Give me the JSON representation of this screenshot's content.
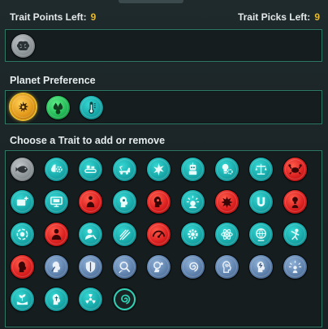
{
  "header": {
    "points_label": "Trait Points Left:",
    "points_value": "9",
    "picks_label": "Trait Picks Left:",
    "picks_value": "9"
  },
  "selected_traits": [
    {
      "icon": "brain-icon",
      "color": "#8c9396"
    }
  ],
  "planet_preference": {
    "title": "Planet Preference",
    "options": [
      {
        "icon": "arid-planet-icon",
        "color": "#e39a1b",
        "selected": true
      },
      {
        "icon": "wet-climate-icon",
        "color": "#22b956",
        "selected": false
      },
      {
        "icon": "thermometer-icon",
        "color": "#17a7a8",
        "selected": false
      }
    ]
  },
  "trait_picker": {
    "title": "Choose a Trait to add or remove",
    "rows": [
      [
        {
          "icon": "fish-icon",
          "color": "grey"
        },
        {
          "icon": "brain-gear-icon",
          "color": "teal"
        },
        {
          "icon": "conveyor-icon",
          "color": "teal"
        },
        {
          "icon": "mining-vehicle-icon",
          "color": "teal"
        },
        {
          "icon": "star-burst-icon",
          "color": "teal"
        },
        {
          "icon": "robot-icon",
          "color": "teal"
        },
        {
          "icon": "lightbulb-gear-icon",
          "color": "teal"
        },
        {
          "icon": "scales-icon",
          "color": "teal"
        },
        {
          "icon": "crab-icon",
          "color": "red"
        }
      ],
      [
        {
          "icon": "film-add-icon",
          "color": "teal"
        },
        {
          "icon": "monitor-icon",
          "color": "teal"
        },
        {
          "icon": "figure-red-icon",
          "color": "red"
        },
        {
          "icon": "head-gear-icon",
          "color": "teal"
        },
        {
          "icon": "head-gear-red-icon",
          "color": "red"
        },
        {
          "icon": "radiant-head-icon",
          "color": "teal"
        },
        {
          "icon": "splat-icon",
          "color": "red"
        },
        {
          "icon": "magnet-icon",
          "color": "teal"
        },
        {
          "icon": "figure-bulb-icon",
          "color": "red"
        }
      ],
      [
        {
          "icon": "gear-cycle-icon",
          "color": "teal"
        },
        {
          "icon": "person-red-icon",
          "color": "red"
        },
        {
          "icon": "worker-icon",
          "color": "teal"
        },
        {
          "icon": "wheat-icon",
          "color": "teal"
        },
        {
          "icon": "gauge-icon",
          "color": "red"
        },
        {
          "icon": "gear-icon",
          "color": "teal"
        },
        {
          "icon": "atom-icon",
          "color": "teal"
        },
        {
          "icon": "globe-person-icon",
          "color": "teal"
        },
        {
          "icon": "fighter-icon",
          "color": "teal"
        }
      ],
      [
        {
          "icon": "head-red-icon",
          "color": "red"
        },
        {
          "icon": "head-gears-icon",
          "color": "blue"
        },
        {
          "icon": "shield-head-icon",
          "color": "blue"
        },
        {
          "icon": "search-head-icon",
          "color": "blue"
        },
        {
          "icon": "head-ideas-icon",
          "color": "blue"
        },
        {
          "icon": "swirl-icon",
          "color": "blue"
        },
        {
          "icon": "spiral-head-icon",
          "color": "blue"
        },
        {
          "icon": "charged-head-icon",
          "color": "blue"
        },
        {
          "icon": "radiant-figure-icon",
          "color": "blue"
        }
      ],
      [
        {
          "icon": "plant-hands-icon",
          "color": "teal"
        },
        {
          "icon": "head-tree-icon",
          "color": "teal"
        },
        {
          "icon": "radiation-icon",
          "color": "teal"
        },
        {
          "icon": "spiral-galaxy-icon",
          "color": "outline"
        }
      ]
    ]
  },
  "colors": {
    "accent_yellow": "#e8b92c",
    "frame_green": "#2f7a66",
    "teal": "#17a7a8",
    "red": "#d91e1e",
    "blue": "#5d80ab",
    "grey": "#8c9396"
  }
}
